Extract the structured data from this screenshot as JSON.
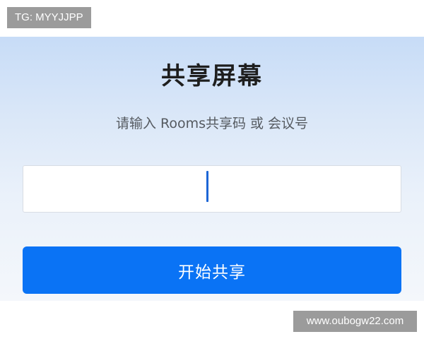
{
  "watermark": {
    "top_left": "TG: MYYJJPP",
    "bottom_right": "www.oubogw22.com"
  },
  "dialog": {
    "title": "共享屏幕",
    "subtitle": "请输入 Rooms共享码 或 会议号",
    "input_value": "",
    "button_label": "开始共享"
  },
  "colors": {
    "primary_button": "#0a73f5",
    "caret": "#1d66d6",
    "title_text": "#1e1e1e",
    "panel_gradient_top": "#c7dcf7"
  }
}
